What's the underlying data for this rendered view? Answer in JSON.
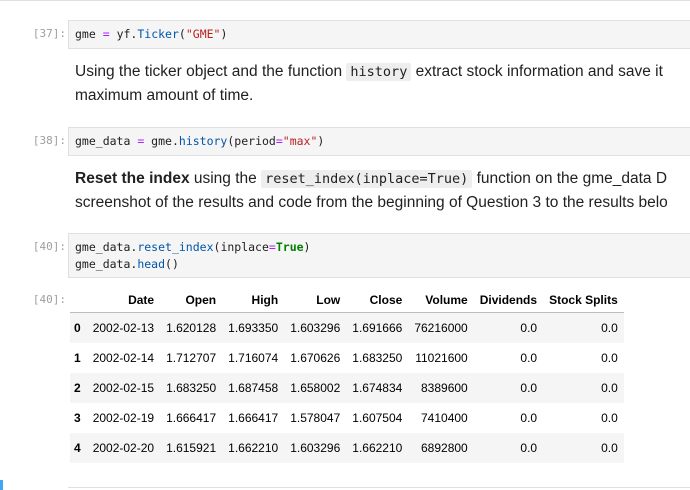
{
  "cells": {
    "c37": {
      "prompt": "[37]:",
      "line1": {
        "var": "gme",
        "eq": " = ",
        "mod": "yf",
        "dot": ".",
        "fn": "Ticker",
        "open": "(",
        "arg": "\"GME\"",
        "close": ")"
      }
    },
    "md1": {
      "text_a": "Using the ticker object and the function ",
      "code": "history",
      "text_b": " extract stock information and save it",
      "line2": "maximum amount of time."
    },
    "c38": {
      "prompt": "[38]:",
      "line1": {
        "var": "gme_data",
        "eq": " = ",
        "obj": "gme",
        "dot": ".",
        "fn": "history",
        "open": "(",
        "kwarg": "period",
        "kweq": "=",
        "arg": "\"max\"",
        "close": ")"
      }
    },
    "md2": {
      "bold": "Reset the index",
      "text_a": " using the ",
      "code": "reset_index(inplace=True)",
      "text_b": " function on the gme_data D",
      "line2": "screenshot of the results and code from the beginning of Question 3 to the results belo"
    },
    "c40": {
      "prompt": "[40]:",
      "line1": {
        "obj": "gme_data",
        "dot": ".",
        "fn": "reset_index",
        "open": "(",
        "kwarg": "inplace",
        "kweq": "=",
        "val": "True",
        "close": ")"
      },
      "line2": {
        "obj": "gme_data",
        "dot": ".",
        "fn": "head",
        "call": "()"
      }
    },
    "out40": {
      "prompt": "[40]:"
    }
  },
  "table": {
    "columns": [
      "",
      "Date",
      "Open",
      "High",
      "Low",
      "Close",
      "Volume",
      "Dividends",
      "Stock Splits"
    ],
    "rows": [
      [
        "0",
        "2002-02-13",
        "1.620128",
        "1.693350",
        "1.603296",
        "1.691666",
        "76216000",
        "0.0",
        "0.0"
      ],
      [
        "1",
        "2002-02-14",
        "1.712707",
        "1.716074",
        "1.670626",
        "1.683250",
        "11021600",
        "0.0",
        "0.0"
      ],
      [
        "2",
        "2002-02-15",
        "1.683250",
        "1.687458",
        "1.658002",
        "1.674834",
        "8389600",
        "0.0",
        "0.0"
      ],
      [
        "3",
        "2002-02-19",
        "1.666417",
        "1.666417",
        "1.578047",
        "1.607504",
        "7410400",
        "0.0",
        "0.0"
      ],
      [
        "4",
        "2002-02-20",
        "1.615921",
        "1.662210",
        "1.603296",
        "1.662210",
        "6892800",
        "0.0",
        "0.0"
      ]
    ]
  },
  "colors": {
    "keyword": "#008000",
    "string": "#ba2121",
    "attribute": "#0055aa",
    "operator": "#aa22ff",
    "prompt": "#9e9e9e",
    "active_cell_marker": "#42a5f5"
  }
}
